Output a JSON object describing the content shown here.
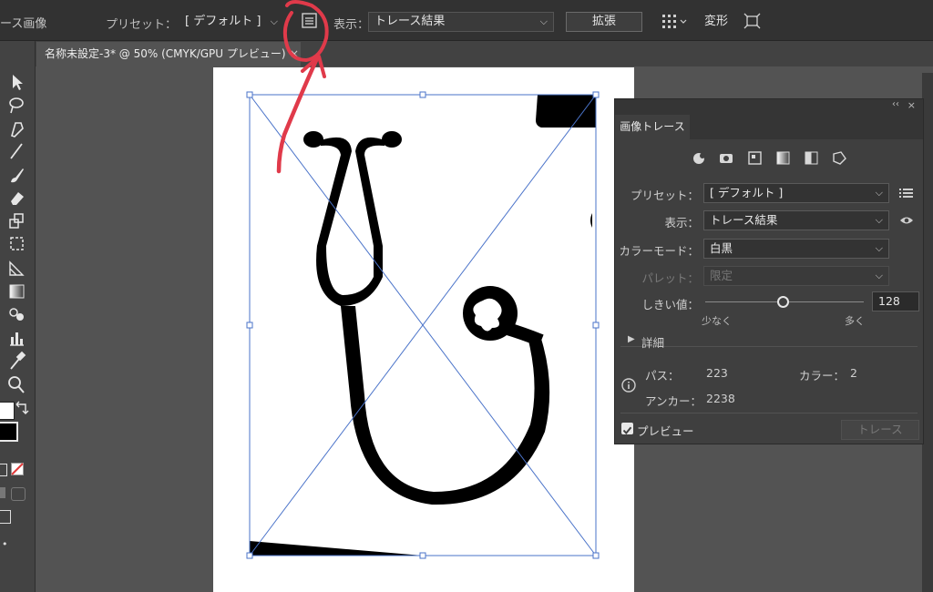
{
  "control_bar": {
    "title": "ース画像",
    "preset_label": "プリセット：",
    "preset_value": "[ デフォルト ]",
    "view_label": "表示：",
    "view_value": "トレース結果",
    "expand_button": "拡張",
    "transform_button": "変形"
  },
  "document_tab": {
    "title": "名称未設定-3* @ 50% (CMYK/GPU プレビュー)",
    "close": "×"
  },
  "panel": {
    "collapse": "‹‹",
    "close": "×",
    "tab": "画像トレース",
    "preset_label": "プリセット：",
    "preset_value": "[ デフォルト ]",
    "view_label": "表示：",
    "view_value": "トレース結果",
    "color_mode_label": "カラーモード：",
    "color_mode_value": "白黒",
    "palette_label": "パレット：",
    "palette_value": "限定",
    "threshold_label": "しきい値：",
    "threshold_value": "128",
    "threshold_fraction": 0.49,
    "slider_min_label": "少なく",
    "slider_max_label": "多く",
    "details_label": "詳細",
    "paths_label": "パス：",
    "paths_value": "223",
    "colors_label": "カラー：",
    "colors_value": "2",
    "anchors_label": "アンカー：",
    "anchors_value": "2238",
    "preview_label": "プレビュー",
    "preview_checked": true,
    "trace_button": "トレース"
  },
  "colors": {
    "accent_annotation": "#e03a4a",
    "selection": "#4a73c9"
  }
}
